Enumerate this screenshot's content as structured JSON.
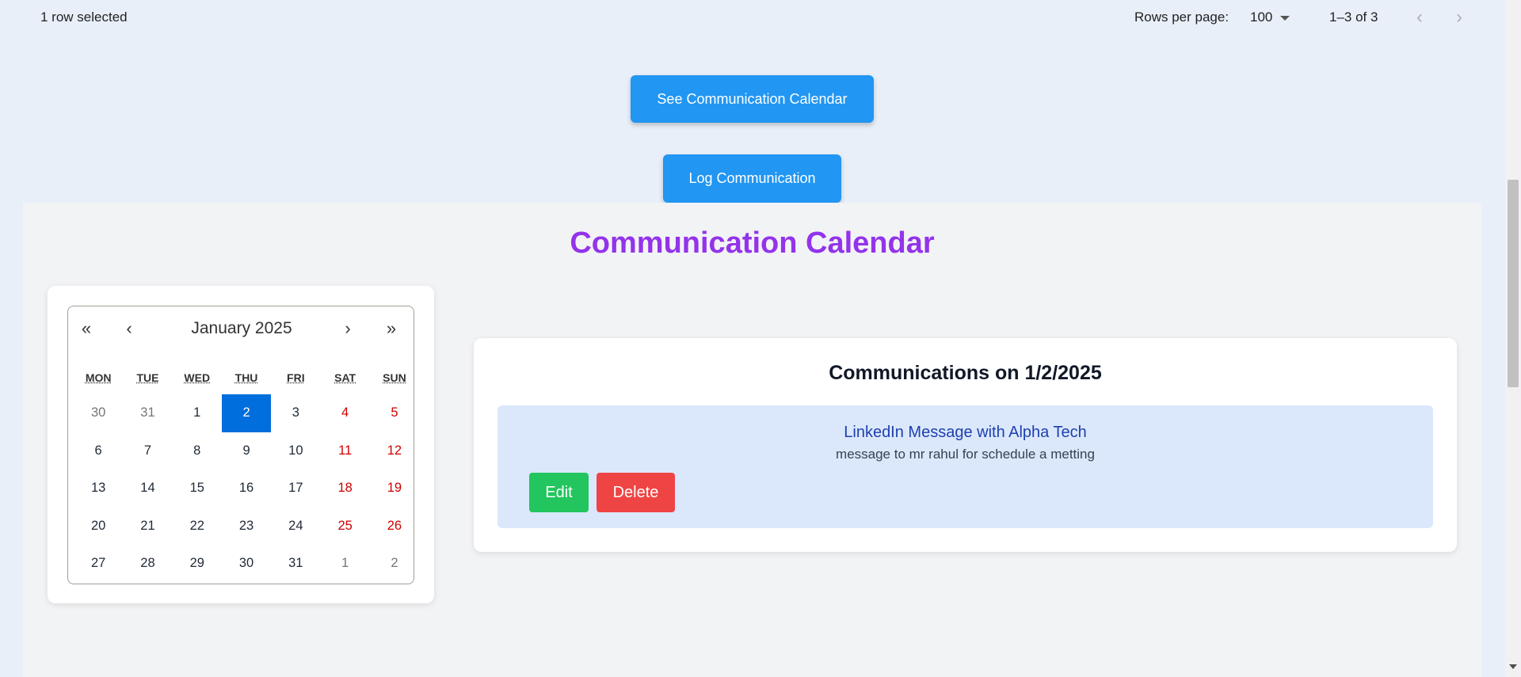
{
  "table_footer": {
    "selected_text": "1 row selected",
    "rows_per_page_label": "Rows per page:",
    "rows_per_page_value": "100",
    "range_text": "1–3 of 3",
    "prev_icon": "‹",
    "next_icon": "›"
  },
  "actions": {
    "see_calendar_label": "See Communication Calendar",
    "log_communication_label": "Log Communication"
  },
  "section": {
    "title": "Communication Calendar"
  },
  "calendar": {
    "nav": {
      "prev2": "«",
      "prev": "‹",
      "label": "January 2025",
      "next": "›",
      "next2": "»"
    },
    "weekdays": [
      "MON",
      "TUE",
      "WED",
      "THU",
      "FRI",
      "SAT",
      "SUN"
    ],
    "days": [
      {
        "n": "30",
        "neighbor": true
      },
      {
        "n": "31",
        "neighbor": true
      },
      {
        "n": "1"
      },
      {
        "n": "2",
        "active": true
      },
      {
        "n": "3"
      },
      {
        "n": "4",
        "weekend": true
      },
      {
        "n": "5",
        "weekend": true
      },
      {
        "n": "6"
      },
      {
        "n": "7"
      },
      {
        "n": "8"
      },
      {
        "n": "9"
      },
      {
        "n": "10"
      },
      {
        "n": "11",
        "weekend": true
      },
      {
        "n": "12",
        "weekend": true
      },
      {
        "n": "13"
      },
      {
        "n": "14"
      },
      {
        "n": "15"
      },
      {
        "n": "16"
      },
      {
        "n": "17"
      },
      {
        "n": "18",
        "weekend": true
      },
      {
        "n": "19",
        "weekend": true
      },
      {
        "n": "20"
      },
      {
        "n": "21"
      },
      {
        "n": "22"
      },
      {
        "n": "23"
      },
      {
        "n": "24"
      },
      {
        "n": "25",
        "weekend": true
      },
      {
        "n": "26",
        "weekend": true
      },
      {
        "n": "27"
      },
      {
        "n": "28"
      },
      {
        "n": "29"
      },
      {
        "n": "30"
      },
      {
        "n": "31"
      },
      {
        "n": "1",
        "weekend": true,
        "neighbor": true
      },
      {
        "n": "2",
        "weekend": true,
        "neighbor": true
      }
    ]
  },
  "communications": {
    "heading": "Communications on 1/2/2025",
    "items": [
      {
        "title": "LinkedIn Message with Alpha Tech",
        "description": "message to mr rahul for schedule a metting",
        "edit_label": "Edit",
        "delete_label": "Delete"
      }
    ]
  },
  "colors": {
    "primary_button": "#2196f3",
    "title_purple": "#9333ea",
    "active_day": "#006edc",
    "weekend_red": "#d10000",
    "edit_green": "#22c55e",
    "delete_red": "#ef4444",
    "item_bg": "#dbe8fc"
  }
}
